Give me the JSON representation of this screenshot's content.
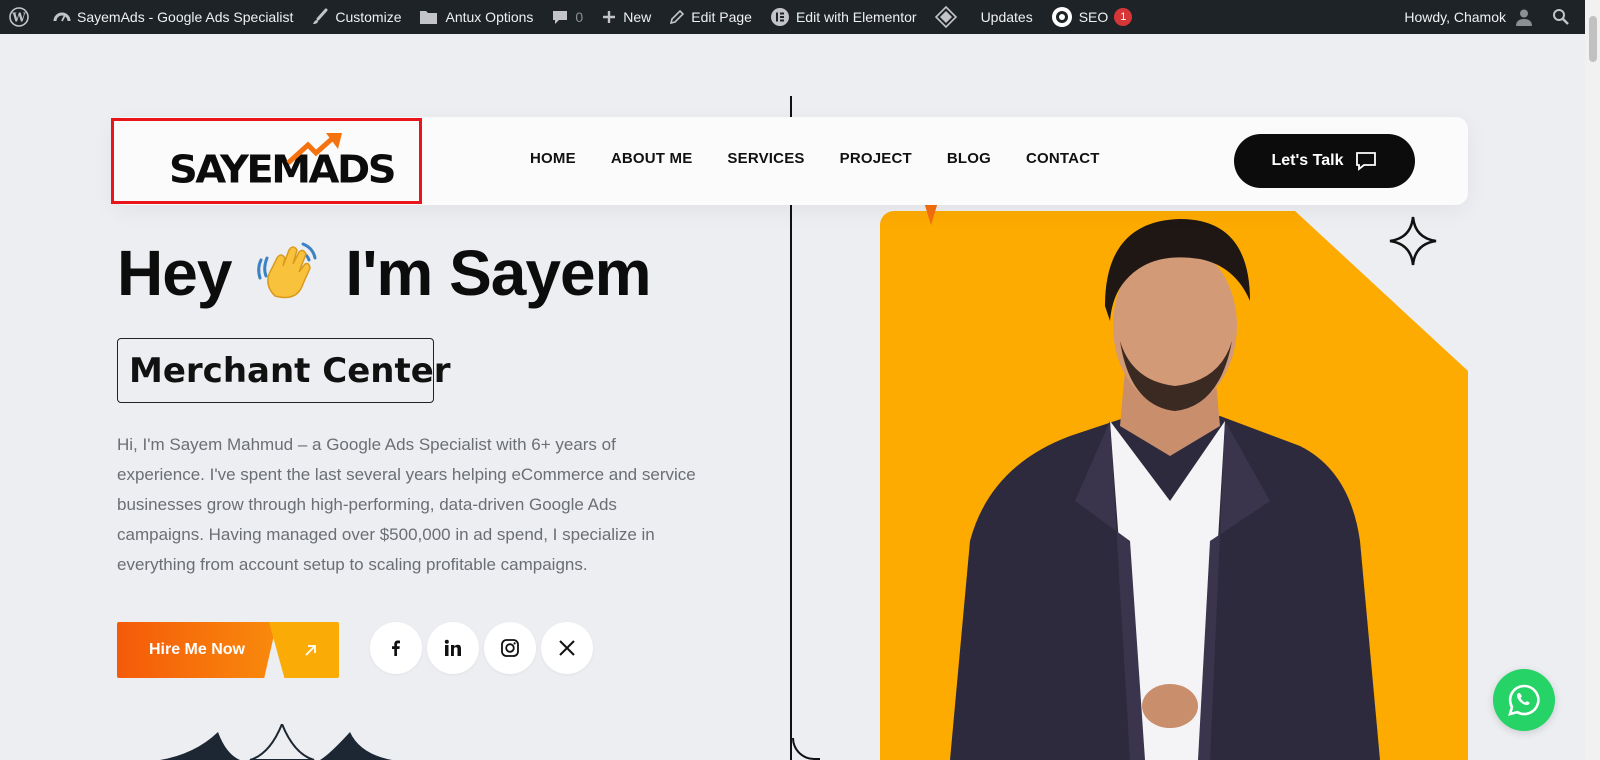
{
  "admin_bar": {
    "site_name": "SayemAds - Google Ads Specialist",
    "customize": "Customize",
    "antux_options": "Antux Options",
    "comments_count": "0",
    "new": "New",
    "edit_page": "Edit Page",
    "edit_elementor": "Edit with Elementor",
    "updates": "Updates",
    "seo": "SEO",
    "seo_badge": "1",
    "howdy": "Howdy, Chamok"
  },
  "header": {
    "logo_text": "SAYEMADS",
    "nav": [
      "HOME",
      "ABOUT ME",
      "SERVICES",
      "PROJECT",
      "BLOG",
      "CONTACT"
    ],
    "cta_label": "Let's Talk"
  },
  "hero": {
    "title_left": "Hey",
    "title_right": "I'm Sayem",
    "typed_text": "Merchant Center",
    "intro": "Hi, I'm Sayem Mahmud – a Google Ads Specialist with 6+ years of experience. I've spent the last several years helping eCommerce and service businesses grow through high-performing, data-driven Google Ads campaigns. Having managed over $500,000 in ad spend, I specialize in everything from account setup to scaling profitable campaigns.",
    "hire_label": "Hire Me Now",
    "socials": [
      "facebook-icon",
      "linkedin-icon",
      "instagram-icon",
      "x-icon"
    ]
  },
  "colors": {
    "accent_orange": "#f55a0a",
    "accent_yellow": "#fdab00",
    "admin_bar": "#1d2327",
    "whatsapp": "#25d366",
    "highlight_box": "#e8161a"
  }
}
